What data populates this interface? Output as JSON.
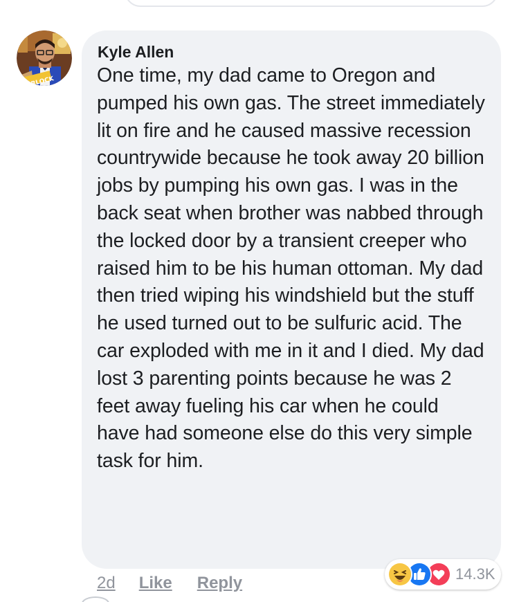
{
  "comment": {
    "author": "Kyle Allen",
    "avatar_icon": "profile-photo",
    "avatar_badge": "WARLOCK",
    "text": "One time, my dad came to Oregon and pumped his own gas. The street immediately lit on fire and he caused massive recession countrywide because he took away 20 billion jobs by pumping his own gas. I was in the back seat when brother was nabbed through the locked door by a transient creeper who raised him to be his human ottoman. My dad then tried wiping his windshield but the stuff he used turned out to be sulfuric acid. The car exploded with me in it and I died. My dad lost 3 parenting points because he was 2 feet away fueling his car when he could have had someone else do this very simple task for him."
  },
  "actions": {
    "timestamp": "2d",
    "like_label": "Like",
    "reply_label": "Reply"
  },
  "reactions": {
    "icons": [
      "haha-icon",
      "like-icon",
      "love-icon"
    ],
    "count": "14.3K"
  },
  "colors": {
    "bubble_bg": "#f0f2f5",
    "text": "#1c1e21",
    "meta": "#90949c",
    "like_blue": "#1877f2",
    "love_red": "#f33e58",
    "haha_yellow": "#f7c644"
  }
}
